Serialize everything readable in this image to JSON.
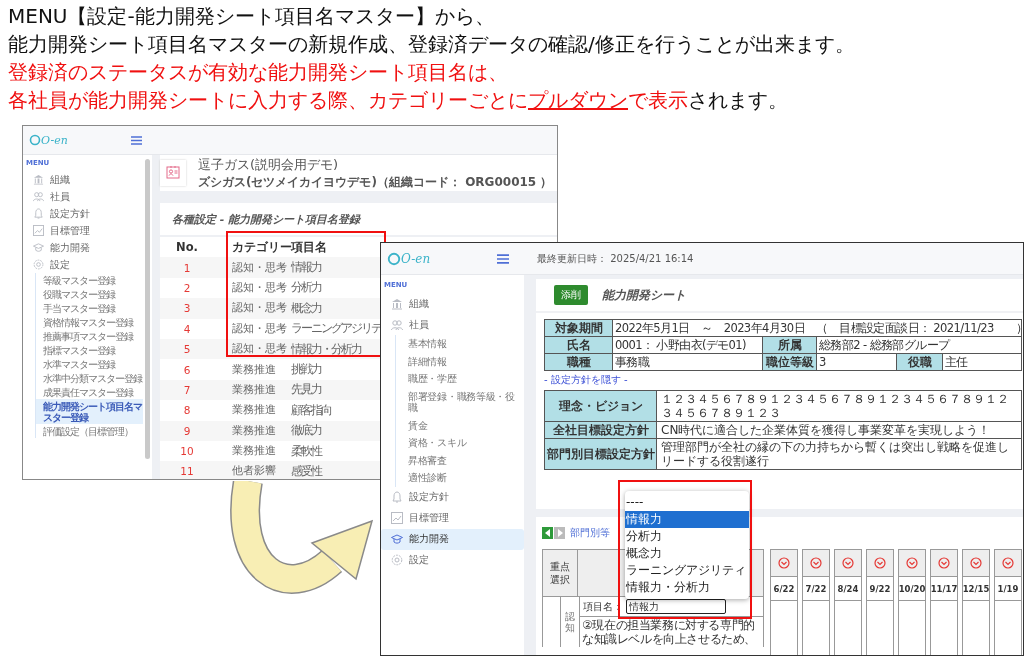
{
  "instructions": {
    "lines": [
      {
        "segments": [
          {
            "text": "MENU【設定-能力開発シート項目名マスター】から、",
            "emphasis": false,
            "underline": false
          }
        ]
      },
      {
        "segments": [
          {
            "text": "能力開発シート項目名マスターの新規作成、登録済データの確認/修正を行うことが出来ます。",
            "emphasis": false,
            "underline": false
          }
        ]
      },
      {
        "segments": [
          {
            "text": "登録済のステータスが有効な能力開発シート項目名は、",
            "emphasis": true,
            "underline": false
          }
        ]
      },
      {
        "segments": [
          {
            "text": "各社員が能力開発シートに入力する際、カテゴリーごとに",
            "emphasis": true,
            "underline": false
          },
          {
            "text": "プルダウン",
            "emphasis": true,
            "underline": true
          },
          {
            "text": "で表示",
            "emphasis": true,
            "underline": false
          },
          {
            "text": "されます。",
            "emphasis": false,
            "underline": false
          }
        ]
      }
    ]
  },
  "master_screen": {
    "logo": "O-en",
    "menu_label": "MENU",
    "nav": [
      {
        "label": "組織",
        "selected": false
      },
      {
        "label": "社員",
        "selected": false
      },
      {
        "label": "設定方針",
        "selected": false
      },
      {
        "label": "目標管理",
        "selected": false
      },
      {
        "label": "能力開発",
        "selected": false
      },
      {
        "label": "設定",
        "selected": false,
        "children": [
          {
            "label": "等級マスター登録",
            "selected": false
          },
          {
            "label": "役職マスター登録",
            "selected": false
          },
          {
            "label": "手当マスター登録",
            "selected": false
          },
          {
            "label": "資格情報マスター登録",
            "selected": false
          },
          {
            "label": "推薦事項マスター登録",
            "selected": false
          },
          {
            "label": "指標マスター登録",
            "selected": false
          },
          {
            "label": "水準マスター登録",
            "selected": false
          },
          {
            "label": "水準中分類マスター登録",
            "selected": false
          },
          {
            "label": "成果責任マスター登録",
            "selected": false
          },
          {
            "label": "能力開発シート項目名マスター登録",
            "selected": true
          },
          {
            "label": "評価設定（目標管理）",
            "selected": false
          }
        ]
      }
    ],
    "org": {
      "name": "逗子ガス(説明会用デモ)",
      "detail": "ズシガス(セツメイカイヨウデモ)（組織コード： ORG00015 ）"
    },
    "panel_title": "各種設定 - 能力開発シート項目名登録",
    "table": {
      "columns": [
        "No.",
        "カテゴリー",
        "項目名"
      ],
      "rows": [
        [
          "1",
          "認知・思考",
          "情報力"
        ],
        [
          "2",
          "認知・思考",
          "分析力"
        ],
        [
          "3",
          "認知・思考",
          "概念力"
        ],
        [
          "4",
          "認知・思考",
          "ラーニングアジリテ"
        ],
        [
          "5",
          "認知・思考",
          "情報力・分析力"
        ],
        [
          "6",
          "業務推進",
          "挑戦力"
        ],
        [
          "7",
          "業務推進",
          "先見力"
        ],
        [
          "8",
          "業務推進",
          "顧客指向"
        ],
        [
          "9",
          "業務推進",
          "徹底力"
        ],
        [
          "10",
          "業務推進",
          "柔軟性"
        ],
        [
          "11",
          "他者影響",
          "感受性"
        ]
      ]
    }
  },
  "sheet_screen": {
    "logo": "O-en",
    "last_updated": "最終更新日時： 2025/4/21 16:14",
    "menu_label": "MENU",
    "nav": [
      {
        "label": "組織",
        "selected": false
      },
      {
        "label": "社員",
        "selected": false,
        "children": [
          {
            "label": "基本情報",
            "selected": false
          },
          {
            "label": "詳細情報",
            "selected": false
          },
          {
            "label": "職歴・学歴",
            "selected": false
          },
          {
            "label": "部署登録・職務等級・役職",
            "selected": false
          },
          {
            "label": "賃金",
            "selected": false
          },
          {
            "label": "資格・スキル",
            "selected": false
          },
          {
            "label": "昇格審査",
            "selected": false
          },
          {
            "label": "適性診断",
            "selected": false
          }
        ]
      },
      {
        "label": "設定方針",
        "selected": false
      },
      {
        "label": "目標管理",
        "selected": false
      },
      {
        "label": "能力開発",
        "selected": true
      },
      {
        "label": "設定",
        "selected": false
      }
    ],
    "edit_button": "添削",
    "title": "能力開発シート",
    "info": [
      {
        "cells": [
          {
            "label": "対象期間",
            "value": "2022年5月1日　～　2023年4月30日　（　目標設定面談日： 2021/11/23　　）"
          }
        ]
      },
      {
        "cells": [
          {
            "label": "氏名",
            "value": "0001： 小野由衣(デモ01)"
          },
          {
            "label": "所属",
            "value": "総務部2 - 総務部グループ"
          }
        ]
      },
      {
        "cells": [
          {
            "label": "職種",
            "value": "事務職"
          },
          {
            "label": "職位等級",
            "value": "3"
          },
          {
            "label": "役職",
            "value": "主任"
          }
        ]
      }
    ],
    "policy_toggle": "- 設定方針を隠す -",
    "policies": [
      {
        "label": "理念・ビジョン",
        "text": "１２３４５６７８９１２３４５６７８９１２３４５６７８９１２３４５６７８９１２３"
      },
      {
        "label": "全社目標設定方針",
        "text": "CN時代に適合した企業体質を獲得し事業変革を実現しよう！"
      },
      {
        "label": "部門別目標設定方針",
        "text": "管理部門が全社の縁の下の力持ちから暫くは突出し戦略を促進しリードする役割遂行"
      }
    ],
    "goals": {
      "nav_title": "部門別等",
      "focus_header": "重点選択",
      "dates": [
        "6/22",
        "7/22",
        "8/24",
        "9/22",
        "10/20",
        "11/17",
        "12/15",
        "1/19"
      ],
      "item_label": "項目名：",
      "item_value": "情報力",
      "category": "認知",
      "description": "②現在の担当業務に対する専門的な知識レベルを向上させるため、",
      "dropdown": [
        {
          "label": "----",
          "selected": false
        },
        {
          "label": "情報力",
          "selected": true
        },
        {
          "label": "分析力",
          "selected": false
        },
        {
          "label": "概念力",
          "selected": false
        },
        {
          "label": "ラーニングアジリティ",
          "selected": false
        },
        {
          "label": "情報力・分析力",
          "selected": false
        }
      ]
    }
  }
}
